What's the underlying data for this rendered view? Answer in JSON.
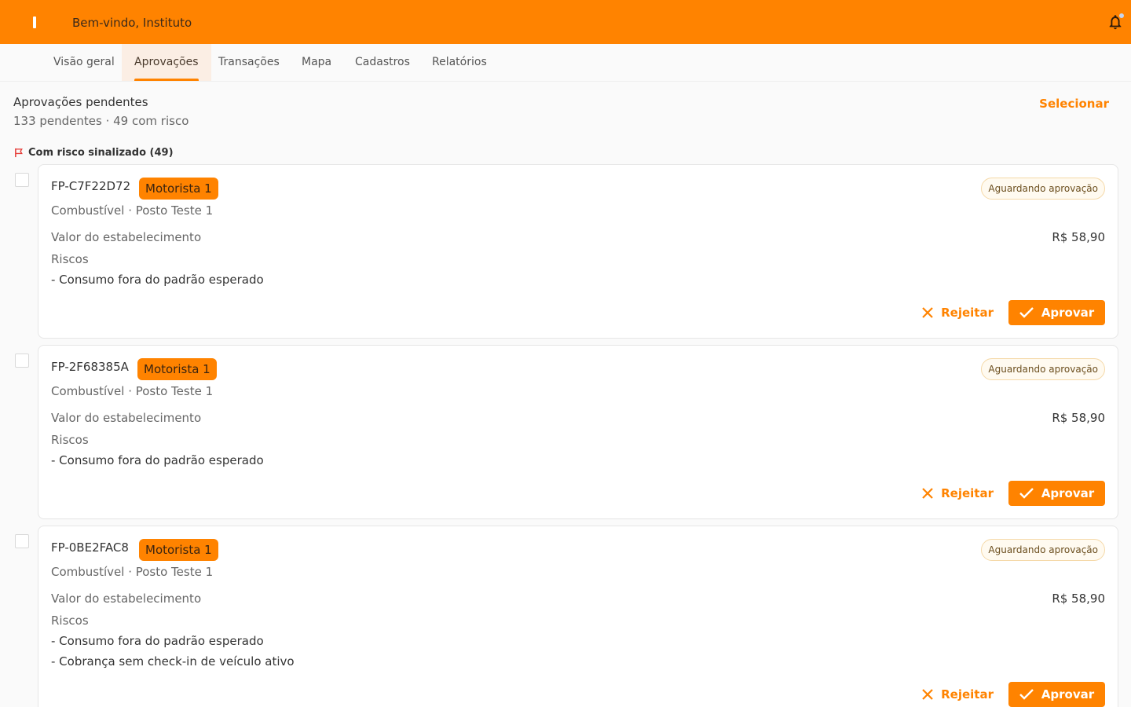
{
  "colors": {
    "brand": "#ff8300",
    "risk_flag": "#e53935"
  },
  "header": {
    "welcome": "Bem-vindo, Instituto",
    "notification_icon": "bell-icon"
  },
  "nav": {
    "tabs": [
      {
        "label": "Visão geral"
      },
      {
        "label": "Aprovações",
        "active": true
      },
      {
        "label": "Transações"
      },
      {
        "label": "Mapa"
      },
      {
        "label": "Cadastros"
      },
      {
        "label": "Relatórios"
      }
    ]
  },
  "approvals": {
    "title": "Aprovações pendentes",
    "summary": "133 pendentes · 49 com risco",
    "select_label": "Selecionar",
    "risk_section_label": "Com risco sinalizado (49)",
    "risk_section_icon": "flag-icon",
    "items": [
      {
        "code": "FP-C7F22D72",
        "driver": "Motorista 1",
        "status": "Aguardando aprovação",
        "subtitle": "Combustível · Posto Teste 1",
        "value_label": "Valor do estabelecimento",
        "value": "R$ 58,90",
        "risks_label": "Riscos",
        "risks": [
          "- Consumo fora do padrão esperado"
        ],
        "reject_label": "Rejeitar",
        "approve_label": "Aprovar"
      },
      {
        "code": "FP-2F68385A",
        "driver": "Motorista 1",
        "status": "Aguardando aprovação",
        "subtitle": "Combustível · Posto Teste 1",
        "value_label": "Valor do estabelecimento",
        "value": "R$ 58,90",
        "risks_label": "Riscos",
        "risks": [
          "- Consumo fora do padrão esperado"
        ],
        "reject_label": "Rejeitar",
        "approve_label": "Aprovar"
      },
      {
        "code": "FP-0BE2FAC8",
        "driver": "Motorista 1",
        "status": "Aguardando aprovação",
        "subtitle": "Combustível · Posto Teste 1",
        "value_label": "Valor do estabelecimento",
        "value": "R$ 58,90",
        "risks_label": "Riscos",
        "risks": [
          "- Consumo fora do padrão esperado",
          "- Cobrança sem check-in de veículo ativo"
        ],
        "reject_label": "Rejeitar",
        "approve_label": "Aprovar"
      }
    ]
  }
}
